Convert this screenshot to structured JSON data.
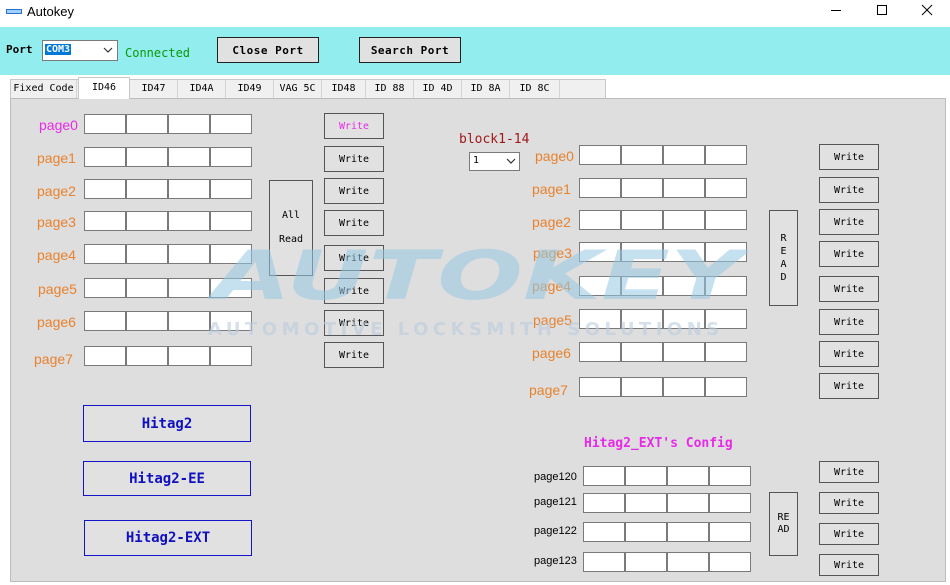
{
  "window": {
    "title": "Autokey",
    "icon": "autokey-logo-icon"
  },
  "toolbar": {
    "port_label": "Port",
    "port_value": "COM3",
    "status": "Connected",
    "close_port_label": "Close Port",
    "search_port_label": "Search Port"
  },
  "tabs": [
    {
      "label": "Fixed Code",
      "active": false
    },
    {
      "label": "ID46",
      "active": true
    },
    {
      "label": "ID47",
      "active": false
    },
    {
      "label": "ID4A",
      "active": false
    },
    {
      "label": "ID49",
      "active": false
    },
    {
      "label": "VAG 5C",
      "active": false
    },
    {
      "label": "ID48",
      "active": false
    },
    {
      "label": "ID 88",
      "active": false
    },
    {
      "label": "ID 4D",
      "active": false
    },
    {
      "label": "ID 8A",
      "active": false
    },
    {
      "label": "ID 8C",
      "active": false
    }
  ],
  "watermark": {
    "main": "AUTOKEY",
    "sub": "AUTOMOTIVE LOCKSMITH SOLUTIONS"
  },
  "left": {
    "pages": [
      "page0",
      "page1",
      "page2",
      "page3",
      "page4",
      "page5",
      "page6",
      "page7"
    ],
    "write_label": "Write",
    "all_read": [
      "All",
      "Read"
    ],
    "hitag_buttons": [
      "Hitag2",
      "Hitag2-EE",
      "Hitag2-EXT"
    ]
  },
  "right": {
    "block_label": "block1-14",
    "block_value": "1",
    "pages": [
      "page0",
      "page1",
      "page2",
      "page3",
      "page4",
      "page5",
      "page6",
      "page7"
    ],
    "write_label": "Write",
    "read_letters": [
      "R",
      "E",
      "A",
      "D"
    ]
  },
  "ext": {
    "title": "Hitag2_EXT's Config",
    "pages": [
      "page120",
      "page121",
      "page122",
      "page123"
    ],
    "write_label": "Write",
    "read_lines": [
      "RE",
      "AD"
    ]
  },
  "colors": {
    "toolbar_bg": "#92eeee",
    "panel_bg": "#dedede",
    "page_label": "#e8822e",
    "highlight_pink": "#e82ae8",
    "hitag_blue": "#1010c0",
    "status_green": "#0a9a0a"
  }
}
